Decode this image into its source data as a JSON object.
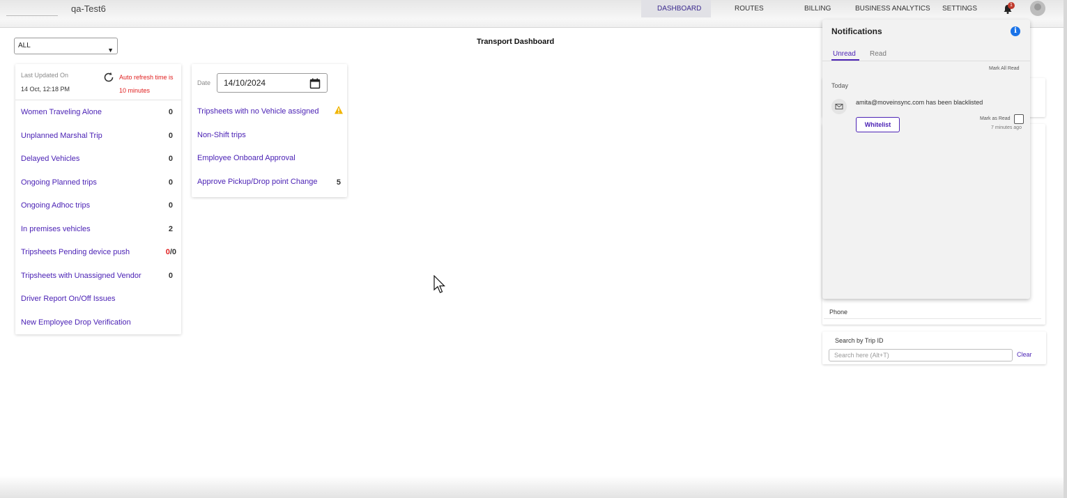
{
  "header": {
    "tenant": "qa-Test6",
    "nav": [
      "DASHBOARD",
      "ROUTES",
      "BILLING",
      "BUSINESS ANALYTICS",
      "SETTINGS"
    ],
    "notification_badge": "1"
  },
  "filter": {
    "selected": "ALL"
  },
  "page_title": "Transport Dashboard",
  "status_card": {
    "last_updated_label": "Last Updated On",
    "last_updated_value": "14 Oct, 12:18 PM",
    "auto_refresh_line1": "Auto refresh time is",
    "auto_refresh_line2": "10 minutes",
    "rows": [
      {
        "label": "Women Traveling Alone",
        "count": "0"
      },
      {
        "label": "Unplanned Marshal Trip",
        "count": "0"
      },
      {
        "label": "Delayed Vehicles",
        "count": "0"
      },
      {
        "label": "Ongoing Planned trips",
        "count": "0"
      },
      {
        "label": "Ongoing Adhoc trips",
        "count": "0"
      },
      {
        "label": "In premises vehicles",
        "count": "2"
      },
      {
        "label": "Tripsheets Pending device push",
        "count_red": "0",
        "count_rest": "/0"
      },
      {
        "label": "Tripsheets with Unassigned Vendor",
        "count": "0"
      },
      {
        "label": "Driver Report On/Off Issues",
        "count": ""
      },
      {
        "label": "New Employee Drop Verification",
        "count": ""
      }
    ]
  },
  "date_card": {
    "date_label": "Date",
    "date_value": "14/10/2024",
    "rows": [
      {
        "label": "Tripsheets with no Vehicle assigned",
        "count": ""
      },
      {
        "label": "Non-Shift trips",
        "count": ""
      },
      {
        "label": "Employee Onboard Approval",
        "count": ""
      },
      {
        "label": "Approve Pickup/Drop point Change",
        "count": "5"
      }
    ]
  },
  "side": {
    "phone_label": "Phone",
    "search_label": "Search by Trip ID",
    "search_placeholder": "Search here (Alt+T)",
    "clear_label": "Clear"
  },
  "notifications": {
    "title": "Notifications",
    "tabs": [
      "Unread",
      "Read"
    ],
    "mark_all": "Mark All Read",
    "group": "Today",
    "message": "amita@moveinsync.com has been blacklisted",
    "action": "Whitelist",
    "mark_read": "Mark as Read",
    "time_ago": "7 minutes ago"
  },
  "colors": {
    "accent": "#4b22b5",
    "alert": "#e02020",
    "info": "#1a73e8"
  }
}
